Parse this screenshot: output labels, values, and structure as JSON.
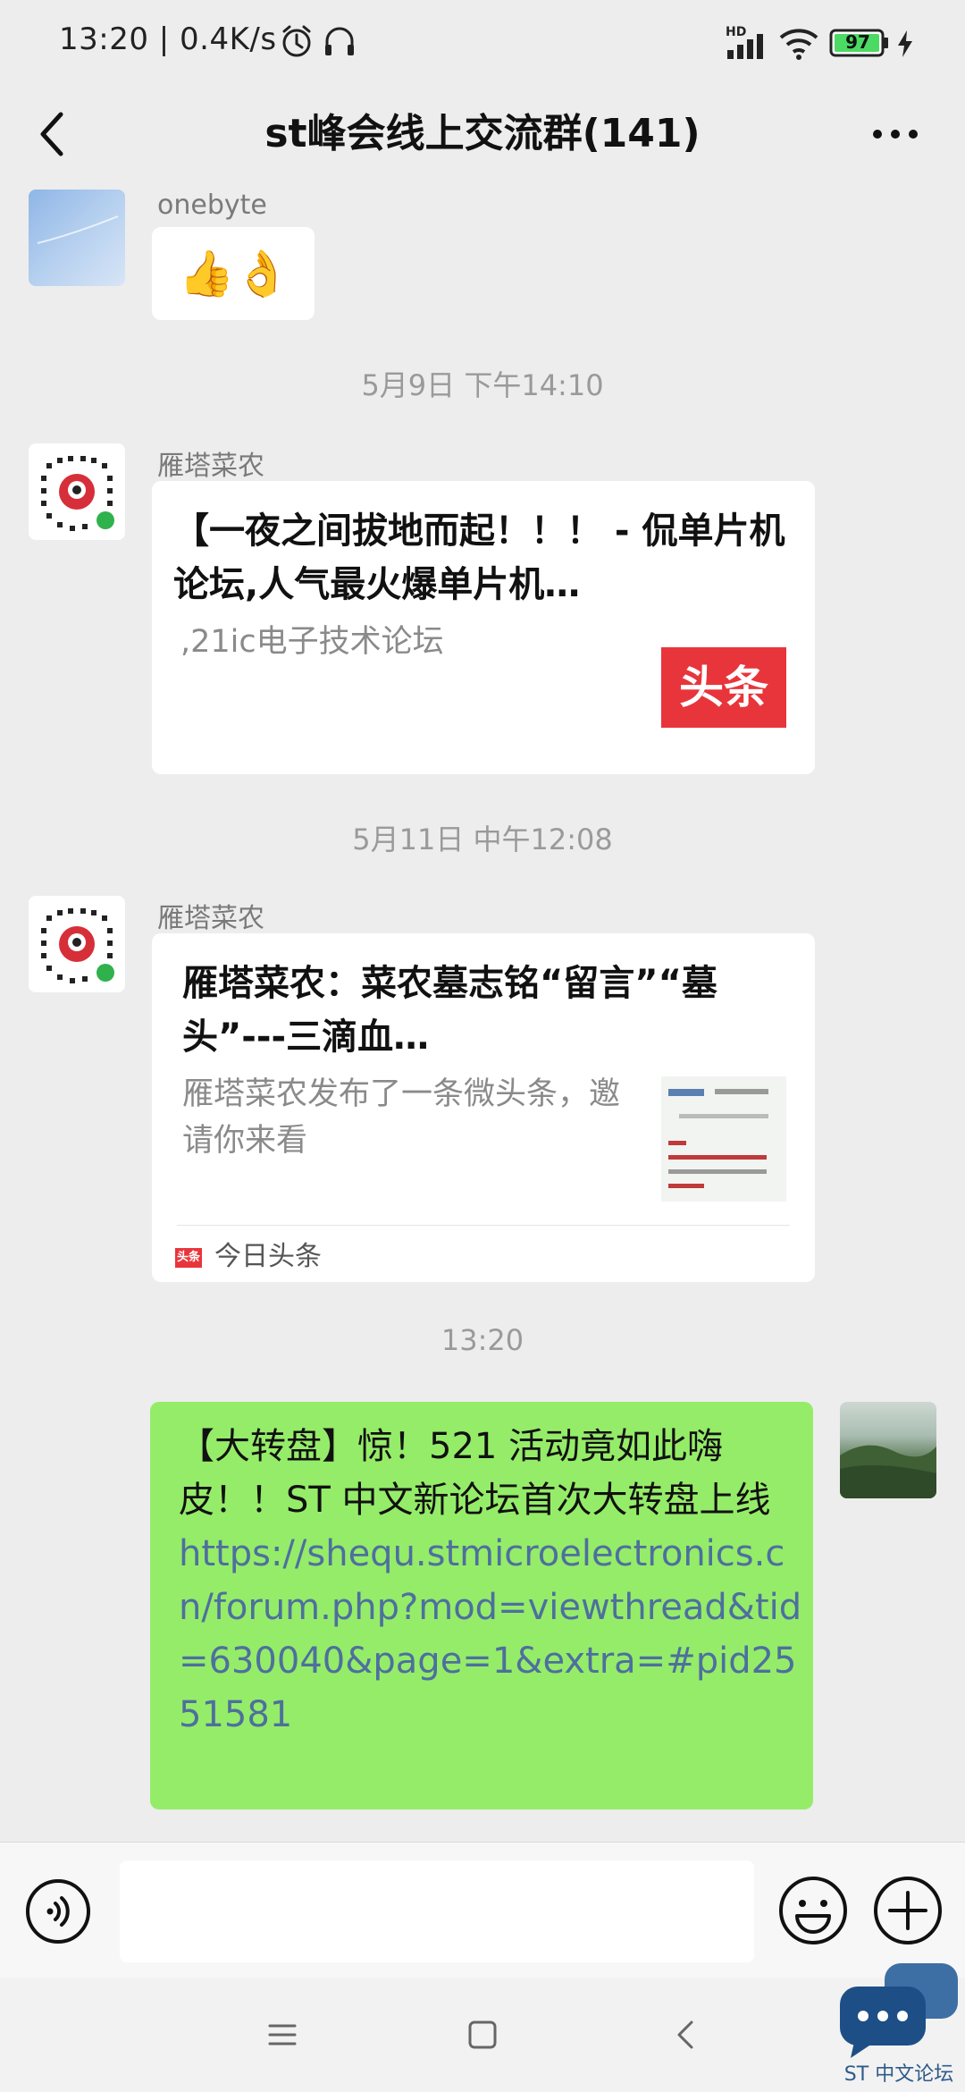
{
  "status_bar": {
    "time_speed": "13:20 | 0.4K/s",
    "network_badge": "HD",
    "battery": "97",
    "icons": [
      "alarm-icon",
      "headphones-icon",
      "signal-icon",
      "wifi-icon",
      "battery-icon",
      "charging-icon"
    ]
  },
  "header": {
    "title": "st峰会线上交流群(141)",
    "back_icon": "back-chevron-icon",
    "more_icon": "more-icon"
  },
  "messages": [
    {
      "sender": "onebyte",
      "content": "👍👌"
    },
    {
      "timestamp": "5月9日 下午14:10"
    },
    {
      "sender": "雁塔菜农",
      "card": {
        "title": "【一夜之间拔地而起！！！ - 侃单片机论坛,人气最火爆单片机…",
        "description": ",21ic电子技术论坛",
        "thumb_text": "头条"
      }
    },
    {
      "timestamp": "5月11日 中午12:08"
    },
    {
      "sender": "雁塔菜农",
      "card": {
        "title": "雁塔菜农：菜农墓志铭“留言”“墓头”---三滴血…",
        "description": "雁塔菜农发布了一条微头条，邀请你来看",
        "source_badge": "头条",
        "source": "今日头条"
      }
    },
    {
      "timestamp": "13:20"
    },
    {
      "from_me": true,
      "text": "【大转盘】惊！521 活动竟如此嗨皮！！ST 中文新论坛首次大转盘上线 ",
      "link": "https://shequ.stmicroelectronics.cn/forum.php?mod=viewthread&tid=630040&page=1&extra=#pid2551581"
    }
  ],
  "input_bar": {
    "voice_icon": "voice-icon",
    "message_placeholder": "",
    "emoji_icon": "emoji-icon",
    "add_icon": "add-icon"
  },
  "nav_bar": {
    "icons": [
      "menu-icon",
      "home-icon",
      "back-icon"
    ]
  },
  "watermark": {
    "text": "ST 中文论坛"
  },
  "colors": {
    "background": "#ededed",
    "sent_bubble": "#95ec69",
    "link": "#4e6f9e",
    "toutiao_red": "#e8353b"
  }
}
